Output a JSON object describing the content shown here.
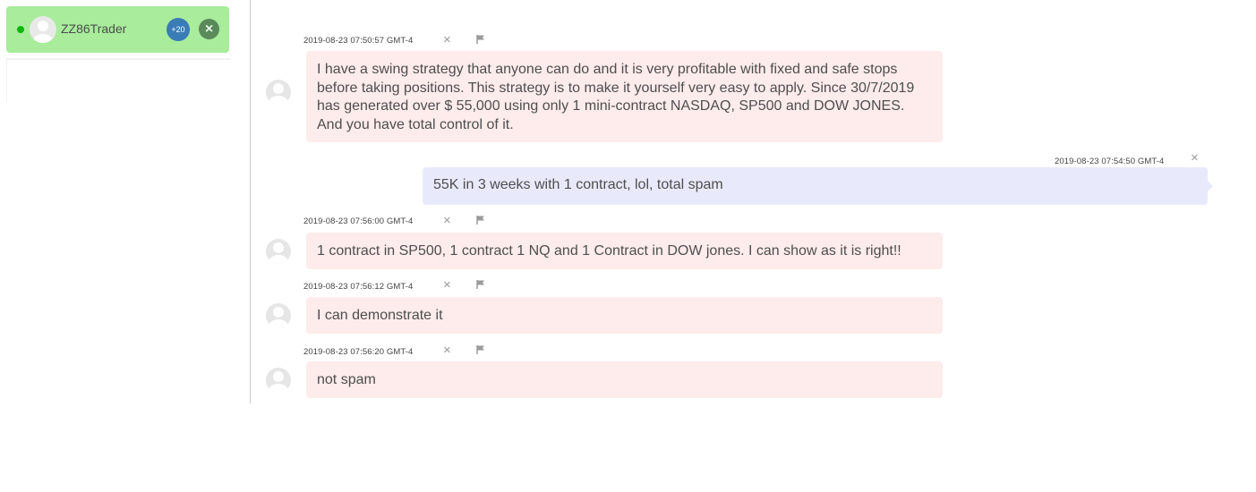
{
  "sidebar": {
    "contact": {
      "name": "ZZ86Trader",
      "badge_count": "+20",
      "online_color": "#0bb80b"
    }
  },
  "messages": [
    {
      "direction": "incoming",
      "timestamp": "2019-08-23 07:50:57 GMT-4",
      "text": "I have a swing strategy that anyone can do and it is very profitable with fixed and safe stops before taking positions. This strategy is to make it yourself very easy to apply. Since 30/7/2019 has generated over $ 55,000 using only 1 mini-contract NASDAQ, SP500 and DOW JONES. And you have total control of it."
    },
    {
      "direction": "outgoing",
      "timestamp": "2019-08-23 07:54:50 GMT-4",
      "text": "55K in 3 weeks with 1 contract, lol, total spam"
    },
    {
      "direction": "incoming",
      "timestamp": "2019-08-23 07:56:00 GMT-4",
      "text": "1 contract in SP500, 1 contract 1 NQ and 1 Contract in DOW jones. I can show as it is right!!"
    },
    {
      "direction": "incoming",
      "timestamp": "2019-08-23 07:56:12 GMT-4",
      "text": "I can demonstrate it"
    },
    {
      "direction": "incoming",
      "timestamp": "2019-08-23 07:56:20 GMT-4",
      "text": "not spam"
    }
  ],
  "icons": {
    "delete": "×",
    "close": "×",
    "flag": "flag-icon"
  },
  "colors": {
    "incoming_bubble": "#fdeceb",
    "outgoing_bubble": "#e8eafc",
    "contact_bg": "#a8ec9c",
    "badge": "#3a7cb5"
  }
}
